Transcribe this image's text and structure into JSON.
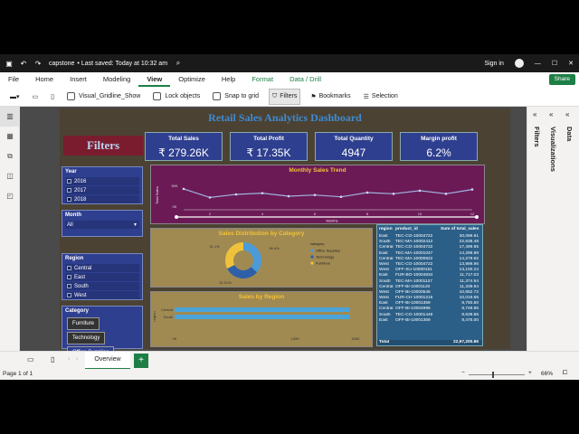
{
  "titlebar": {
    "file_name": "capstone",
    "saved": "• Last saved: Today at 10:32 am",
    "signin": "Sign in",
    "min": "—",
    "max": "☐",
    "close": "✕"
  },
  "menu": {
    "items": [
      "File",
      "Home",
      "Insert",
      "Modeling",
      "View",
      "Optimize",
      "Help",
      "Format",
      "Data / Drill"
    ],
    "active": "View",
    "share": "Share"
  },
  "toolbar": {
    "gridline": "Visual_Gridline_Show",
    "lock": "Lock objects",
    "snap": "Snap to grid",
    "filters": "Filters",
    "bookmarks": "Bookmarks",
    "selection": "Selection"
  },
  "report": {
    "title": "Retail Sales Analytics Dashboard",
    "filters_header": "Filters"
  },
  "kpis": [
    {
      "label": "Total Sales",
      "value": "₹ 279.26K"
    },
    {
      "label": "Total Profit",
      "value": "₹ 17.35K"
    },
    {
      "label": "Total Quantity",
      "value": "4947"
    },
    {
      "label": "Margin profit",
      "value": "6.2%"
    }
  ],
  "slicers": {
    "year": {
      "title": "Year",
      "items": [
        "2016",
        "2017",
        "2018"
      ]
    },
    "month": {
      "title": "Month",
      "value": "All"
    },
    "region": {
      "title": "Region",
      "items": [
        "Central",
        "East",
        "South",
        "West"
      ]
    },
    "category": {
      "title": "Category",
      "items": [
        "Furniture",
        "Technology",
        "Office Supplies"
      ]
    }
  },
  "charts": {
    "monthly": {
      "title": "Monthly Sales Trend",
      "xlabel": "Months",
      "ylabel": "Total Sales",
      "ytick_hi": "50K",
      "ytick_lo": "0K"
    },
    "distribution": {
      "title": "Sales Distribution by Category",
      "legend_title": "category",
      "legend": [
        "Office Supplies",
        "Technology",
        "Furniture"
      ],
      "labels": [
        "31.1%",
        "36.4%",
        "32.51%"
      ]
    },
    "region": {
      "title": "Sales by Region",
      "ylabel": "region",
      "bars": [
        "Central",
        "South"
      ],
      "ticks": [
        "0K",
        "100K",
        "150K"
      ]
    }
  },
  "chart_data": [
    {
      "type": "line",
      "title": "Monthly Sales Trend",
      "xlabel": "Months",
      "ylabel": "Total Sales",
      "x": [
        1,
        2,
        3,
        4,
        5,
        6,
        7,
        8,
        9,
        10,
        11,
        12
      ],
      "values": [
        34,
        20,
        25,
        27,
        22,
        24,
        21,
        28,
        26,
        31,
        26,
        33
      ],
      "xticks": [
        "2",
        "4",
        "6",
        "8",
        "10",
        "12"
      ]
    },
    {
      "type": "pie",
      "title": "Sales Distribution by Category",
      "categories": [
        "Office Supplies",
        "Technology",
        "Furniture"
      ],
      "values": [
        36.4,
        31.1,
        32.51
      ]
    },
    {
      "type": "bar",
      "title": "Sales by Region",
      "categories": [
        "Central",
        "South"
      ],
      "values": [
        145,
        145
      ]
    }
  ],
  "table": {
    "headers": [
      "region",
      "product_id",
      "Sum of total_sales"
    ],
    "rows": [
      [
        "East",
        "TEC-CO-10004722",
        "30,099.91"
      ],
      [
        "South",
        "TEC-MA-10002412",
        "22,638.48"
      ],
      [
        "Central",
        "TEC-CO-10004722",
        "17,499.95"
      ],
      [
        "East",
        "TEC-MA-10001047",
        "14,299.89"
      ],
      [
        "Central",
        "TEC-MA-10000822",
        "14,279.92"
      ],
      [
        "West",
        "TEC-CO-10004722",
        "13,999.96"
      ],
      [
        "West",
        "OFF-SU-10000151",
        "13,100.24"
      ],
      [
        "East",
        "FUR-BO-10004834",
        "11,717.03"
      ],
      [
        "South",
        "TEC-MA-10001127",
        "11,374.94"
      ],
      [
        "Central",
        "OFF-BI-10001120",
        "11,339.94"
      ],
      [
        "West",
        "OFF-BI-10000545",
        "10,652.72"
      ],
      [
        "West",
        "FUR-CH-10001215",
        "10,019.65"
      ],
      [
        "East",
        "OFF-BI-10001359",
        "8,750.50"
      ],
      [
        "Central",
        "OFF-BI-10004995",
        "8,749.95"
      ],
      [
        "South",
        "TEC-CO-10001449",
        "8,639.86"
      ],
      [
        "East",
        "OFF-BI-10001359",
        "8,475.00"
      ]
    ],
    "total_label": "Total",
    "total": "22,97,200.86"
  },
  "panes": {
    "filters": "Filters",
    "visualizations": "Visualizations",
    "data": "Data"
  },
  "tabs": {
    "page": "Overview",
    "add": "+"
  },
  "status": {
    "page": "Page 1 of 1",
    "zoom": "66%"
  }
}
